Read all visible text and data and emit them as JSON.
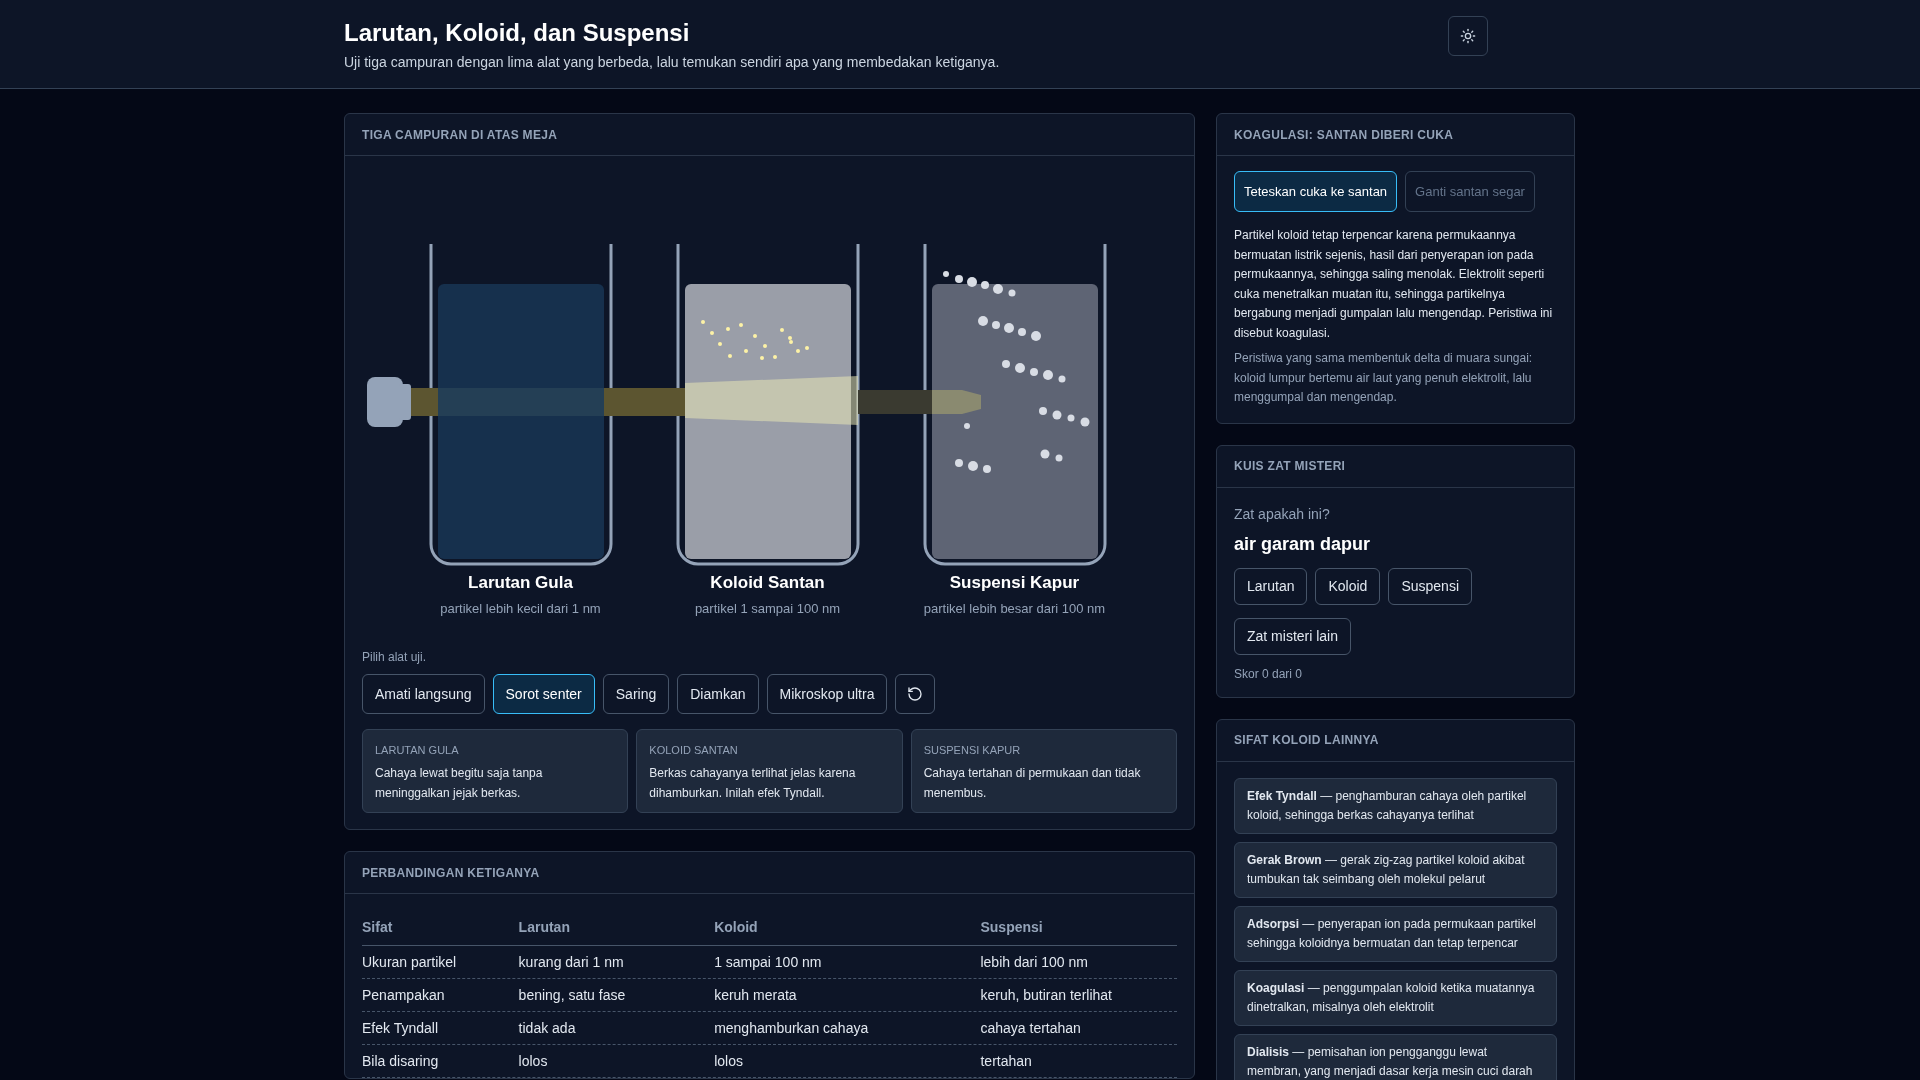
{
  "header": {
    "title": "Larutan, Koloid, dan Suspensi",
    "subtitle": "Uji tiga campuran dengan lima alat yang berbeda, lalu temukan sendiri apa yang membedakan ketiganya."
  },
  "lab": {
    "title": "TIGA CAMPURAN DI ATAS MEJA",
    "flashlight_on": true,
    "beakers": [
      {
        "kind": "solution",
        "name": "Larutan Gula",
        "subtitle": "partikel lebih kecil dari 1 nm"
      },
      {
        "kind": "colloid",
        "name": "Koloid Santan",
        "subtitle": "partikel 1 sampai 100 nm"
      },
      {
        "kind": "suspension",
        "name": "Suspensi Kapur",
        "subtitle": "partikel lebih besar dari 100 nm"
      }
    ],
    "tools_label": "Pilih alat uji.",
    "tools": [
      {
        "label": "Amati langsung",
        "selected": false
      },
      {
        "label": "Sorot senter",
        "selected": true
      },
      {
        "label": "Saring",
        "selected": false
      },
      {
        "label": "Diamkan",
        "selected": false
      },
      {
        "label": "Mikroskop ultra",
        "selected": false
      }
    ],
    "results": [
      {
        "title": "LARUTAN GULA",
        "text": "Cahaya lewat begitu saja tanpa meninggalkan jejak berkas."
      },
      {
        "title": "KOLOID SANTAN",
        "text": "Berkas cahayanya terlihat jelas karena dihamburkan. Inilah efek Tyndall."
      },
      {
        "title": "SUSPENSI KAPUR",
        "text": "Cahaya tertahan di permukaan dan tidak menembus."
      }
    ]
  },
  "comparison": {
    "title": "PERBANDINGAN KETIGANYA",
    "columns": [
      "Sifat",
      "Larutan",
      "Koloid",
      "Suspensi"
    ],
    "rows": [
      [
        "Ukuran partikel",
        "kurang dari 1 nm",
        "1 sampai 100 nm",
        "lebih dari 100 nm"
      ],
      [
        "Penampakan",
        "bening, satu fase",
        "keruh merata",
        "keruh, butiran terlihat"
      ],
      [
        "Efek Tyndall",
        "tidak ada",
        "menghamburkan cahaya",
        "cahaya tertahan"
      ],
      [
        "Bila disaring",
        "lolos",
        "lolos",
        "tertahan"
      ]
    ]
  },
  "coagulation": {
    "title": "KOAGULASI: SANTAN DIBERI CUKA",
    "buttons": [
      {
        "label": "Teteskan cuka ke santan",
        "selected": true,
        "disabled": false
      },
      {
        "label": "Ganti santan segar",
        "selected": false,
        "disabled": true
      }
    ],
    "explanation": "Partikel koloid tetap terpencar karena permukaannya bermuatan listrik sejenis, hasil dari penyerapan ion pada permukaannya, sehingga saling menolak. Elektrolit seperti cuka menetralkan muatan itu, sehingga partikelnya bergabung menjadi gumpalan lalu mengendap. Peristiwa ini disebut koagulasi.",
    "note": "Peristiwa yang sama membentuk delta di muara sungai: koloid lumpur bertemu air laut yang penuh elektrolit, lalu menggumpal dan mengendap."
  },
  "quiz": {
    "title": "KUIS ZAT MISTERI",
    "prompt": "Zat apakah ini?",
    "substance": "air garam dapur",
    "options": [
      "Larutan",
      "Koloid",
      "Suspensi"
    ],
    "next": "Zat misteri lain",
    "score": "Skor 0 dari 0"
  },
  "properties": {
    "title": "SIFAT KOLOID LAINNYA",
    "items": [
      "**Efek Tyndall** — penghamburan cahaya oleh partikel koloid, sehingga berkas cahayanya terlihat",
      "**Gerak Brown** — gerak zig-zag partikel koloid akibat tumbukan tak seimbang oleh molekul pelarut",
      "**Adsorpsi** — penyerapan ion pada permukaan partikel sehingga koloidnya bermuatan dan tetap terpencar",
      "**Koagulasi** — penggumpalan koloid ketika muatannya dinetralkan, misalnya oleh elektrolit",
      "**Dialisis** — pemisahan ion pengganggu lewat membran, yang menjadi dasar kerja mesin cuci darah"
    ]
  }
}
